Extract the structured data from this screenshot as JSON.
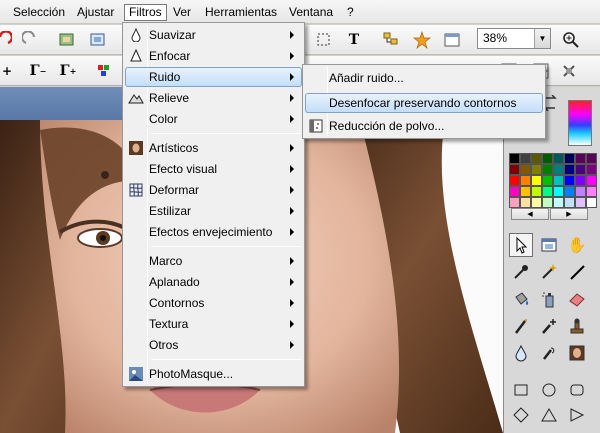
{
  "menubar": {
    "items": [
      "Selección",
      "Ajustar",
      "Filtros",
      "Ver",
      "Herramientas",
      "Ventana",
      "?"
    ]
  },
  "toolbar": {
    "zoom_value": "38%"
  },
  "filters_menu": {
    "items": [
      {
        "label": "Suavizar",
        "icon": "smooth-icon",
        "submenu": true
      },
      {
        "label": "Enfocar",
        "icon": "sharpen-icon",
        "submenu": true
      },
      {
        "label": "Ruido",
        "icon": "",
        "submenu": true,
        "highlighted": true
      },
      {
        "label": "Relieve",
        "icon": "relief-icon",
        "submenu": true
      },
      {
        "label": "Color",
        "icon": "",
        "submenu": true
      },
      {
        "label": "Artísticos",
        "icon": "artistic-portrait-icon",
        "submenu": true
      },
      {
        "label": "Efecto visual",
        "icon": "",
        "submenu": true
      },
      {
        "label": "Deformar",
        "icon": "deform-grid-icon",
        "submenu": true
      },
      {
        "label": "Estilizar",
        "icon": "",
        "submenu": true
      },
      {
        "label": "Efectos envejecimiento",
        "icon": "",
        "submenu": true
      },
      {
        "label": "Marco",
        "icon": "",
        "submenu": true
      },
      {
        "label": "Aplanado",
        "icon": "",
        "submenu": true
      },
      {
        "label": "Contornos",
        "icon": "",
        "submenu": true
      },
      {
        "label": "Textura",
        "icon": "",
        "submenu": true
      },
      {
        "label": "Otros",
        "icon": "",
        "submenu": true
      },
      {
        "label": "PhotoMasque...",
        "icon": "photomasque-icon",
        "submenu": false
      }
    ]
  },
  "noise_submenu": {
    "items": [
      {
        "label": "Añadir ruido...",
        "icon": ""
      },
      {
        "label": "Desenfocar preservando contornos",
        "icon": "",
        "highlighted": true
      },
      {
        "label": "Reducción de polvo...",
        "icon": "dust-reduction-icon"
      }
    ]
  },
  "palette": {
    "colors": [
      "#000000",
      "#404040",
      "#5a5a00",
      "#005a00",
      "#005a5a",
      "#00005a",
      "#5a005a",
      "#5a005a",
      "#7f0000",
      "#7f5a00",
      "#7f7f00",
      "#007f00",
      "#007f7f",
      "#00007f",
      "#4a007f",
      "#7f007f",
      "#ff0000",
      "#ff7f00",
      "#ffff00",
      "#00c000",
      "#00c0c0",
      "#0000ff",
      "#7f00ff",
      "#ff00ff",
      "#ff00c0",
      "#ffc000",
      "#c0ff00",
      "#00ff7f",
      "#00ffff",
      "#0080ff",
      "#c080ff",
      "#ff80ff",
      "#ffa0c0",
      "#ffe0a0",
      "#ffffa0",
      "#c0ffc0",
      "#c0ffff",
      "#c0e0ff",
      "#e0c0ff",
      "#ffffff"
    ]
  },
  "tools": [
    "pointer-arrow-icon",
    "image-window-icon",
    "hand-pan-icon",
    "eyedropper-icon",
    "magic-wand-icon",
    "line-icon",
    "paint-bucket-icon",
    "spray-can-icon",
    "eraser-icon",
    "brush-icon",
    "brush-plus-icon",
    "stamp-icon",
    "water-drop-icon",
    "smudge-icon",
    "portrait-icon",
    "rectangle-shape-icon",
    "ellipse-shape-icon",
    "rounded-rectangle-icon",
    "diamond-shape-icon",
    "triangle-shape-icon",
    "arrow-shape-icon"
  ]
}
